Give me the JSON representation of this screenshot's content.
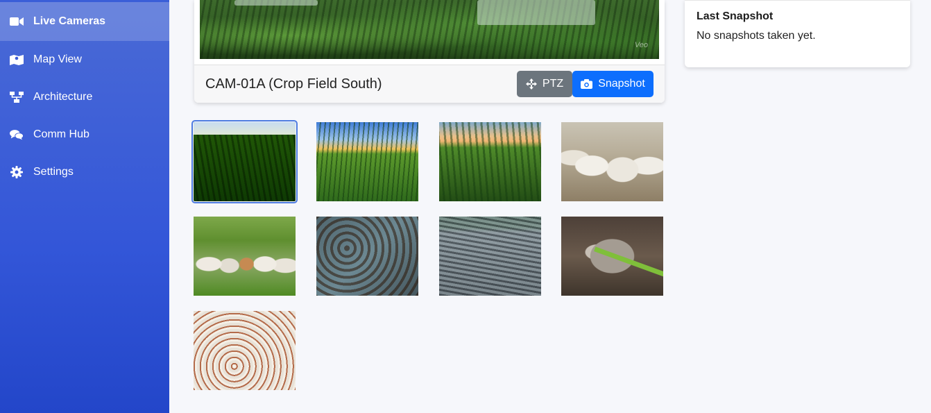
{
  "sidebar": {
    "items": [
      {
        "label": "Live Cameras",
        "icon": "video-camera-icon",
        "active": true
      },
      {
        "label": "Map View",
        "icon": "map-icon",
        "active": false
      },
      {
        "label": "Architecture",
        "icon": "network-icon",
        "active": false
      },
      {
        "label": "Comm Hub",
        "icon": "chat-bubbles-icon",
        "active": false
      },
      {
        "label": "Settings",
        "icon": "gear-icon",
        "active": false
      }
    ]
  },
  "camera": {
    "title": "CAM-01A (Crop Field South)",
    "ptz_label": "PTZ",
    "snapshot_label": "Snapshot",
    "watermark": "Veo"
  },
  "snapshot_panel": {
    "title": "Last Snapshot",
    "text": "No snapshots taken yet."
  },
  "thumbnails": [
    {
      "subject": "crop-rows",
      "selected": true
    },
    {
      "subject": "corn-field-sunset",
      "selected": false
    },
    {
      "subject": "corn-field-dusk",
      "selected": false
    },
    {
      "subject": "white-cattle-herd",
      "selected": false
    },
    {
      "subject": "cattle-in-pasture",
      "selected": false
    },
    {
      "subject": "catfish-pond",
      "selected": false
    },
    {
      "subject": "fish-farm-tank",
      "selected": false
    },
    {
      "subject": "grasscutter",
      "selected": false
    },
    {
      "subject": "poultry-house",
      "selected": false
    }
  ],
  "colors": {
    "sidebar": "#3356d8",
    "ptz_button": "#6c757d",
    "snapshot_button": "#0d6efd",
    "selection_outline": "#4d7be0"
  }
}
